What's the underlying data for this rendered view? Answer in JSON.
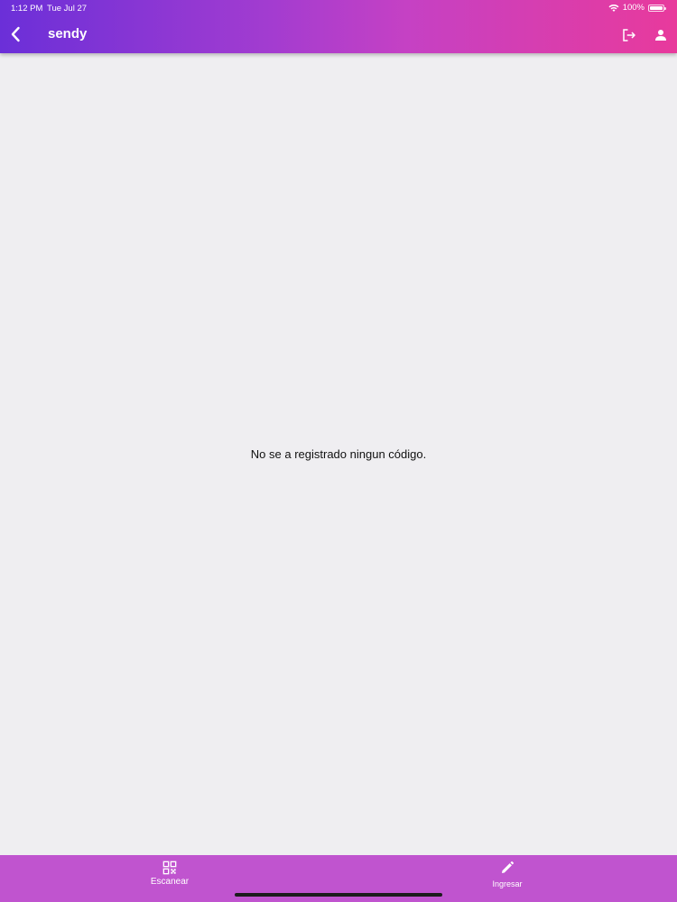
{
  "status_bar": {
    "time": "1:12 PM",
    "date": "Tue Jul 27",
    "battery": "100%",
    "wifi_icon": "wifi-icon",
    "battery_icon": "battery-icon"
  },
  "header": {
    "title": "sendy",
    "back_icon": "chevron-left-icon",
    "logout_icon": "logout-icon",
    "profile_icon": "person-icon",
    "gradient_colors": [
      "#6b2fd8",
      "#c541c4",
      "#e83a9c"
    ]
  },
  "main": {
    "empty_message": "No se a registrado ningun código."
  },
  "bottom_nav": {
    "background": "#c054cf",
    "tabs": [
      {
        "label": "Escanear",
        "icon": "qr-code-icon"
      },
      {
        "label": "Ingresar",
        "icon": "pencil-icon"
      }
    ]
  }
}
